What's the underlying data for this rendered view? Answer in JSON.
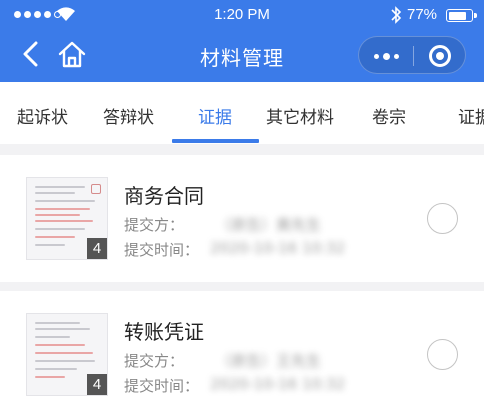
{
  "status_bar": {
    "time": "1:20 PM",
    "battery_percent": "77%",
    "battery_level": 0.77,
    "signal_bars": 4
  },
  "nav": {
    "title": "材料管理",
    "icons": [
      "back-icon",
      "home-icon",
      "more-icon",
      "close-icon"
    ]
  },
  "tabs": [
    {
      "label": "起诉状",
      "active": false
    },
    {
      "label": "答辩状",
      "active": false
    },
    {
      "label": "证据",
      "active": true
    },
    {
      "label": "其它材料",
      "active": false
    },
    {
      "label": "卷宗",
      "active": false
    },
    {
      "label": "证据",
      "active": false
    }
  ],
  "materials": [
    {
      "title": "商务合同",
      "submitter_label": "提交方：",
      "submitter": "（原告）黄先生",
      "submit_time_label": "提交时间：",
      "submit_time": "2020-10-16  10:32",
      "page_count": "4",
      "selected": false
    },
    {
      "title": "转账凭证",
      "submitter_label": "提交方：",
      "submitter": "（原告）王先生",
      "submit_time_label": "提交时间：",
      "submit_time": "2020-10-16  10:32",
      "page_count": "4",
      "selected": false
    }
  ],
  "colors": {
    "accent": "#3b7be9",
    "page_background": "#f2f2f4",
    "inactive_tab_text": "#333333",
    "meta_text": "#888888"
  }
}
